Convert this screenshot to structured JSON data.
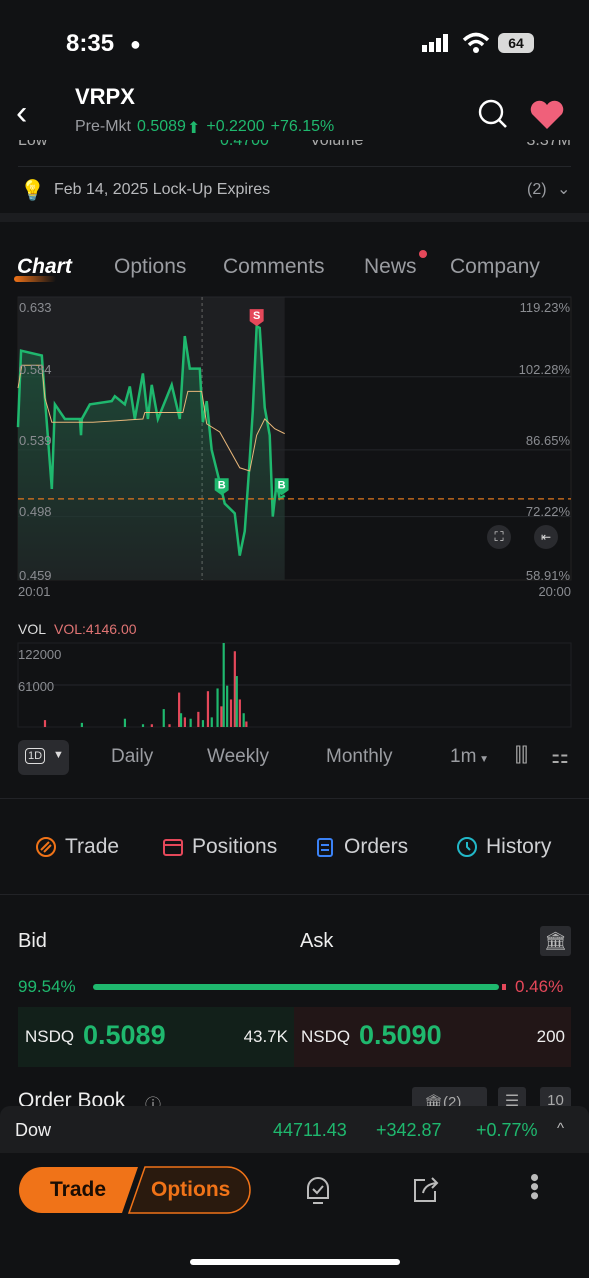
{
  "status": {
    "time": "8:35",
    "battery": "64"
  },
  "header": {
    "symbol": "VRPX",
    "session": "Pre-Mkt",
    "price": "0.5089",
    "change": "+0.2200",
    "change_pct": "+76.15%",
    "partial_row": {
      "low_label": "Low",
      "low_value": "0.4700",
      "volume_label": "Volume",
      "volume_value": "3.37M"
    }
  },
  "event": {
    "text": "Feb 14, 2025 Lock-Up Expires",
    "count": "(2)"
  },
  "tabs": [
    {
      "label": "Chart",
      "active": true
    },
    {
      "label": "Options"
    },
    {
      "label": "Comments"
    },
    {
      "label": "News",
      "dot": true
    },
    {
      "label": "Company"
    }
  ],
  "colors": {
    "up": "#1fb86e",
    "down": "#e5485a",
    "accent": "#f07318",
    "ma": "#e8b77a"
  },
  "chart_data": {
    "type": "line",
    "ylim": [
      0.459,
      0.633
    ],
    "y_ticks": [
      "0.633",
      "0.584",
      "0.539",
      "0.498",
      "0.459"
    ],
    "pct_ticks": [
      "119.23%",
      "102.28%",
      "86.65%",
      "72.22%",
      "58.91%"
    ],
    "x_ticks": [
      "20:01",
      "20:00"
    ],
    "reference_price": 0.5089,
    "session_divider": "04:00",
    "price": [
      [
        "20:01",
        0.553
      ],
      [
        "20:09",
        0.6
      ],
      [
        "21:03",
        0.597
      ],
      [
        "21:11",
        0.571
      ],
      [
        "21:29",
        0.515
      ],
      [
        "21:37",
        0.567
      ],
      [
        "22:03",
        0.558
      ],
      [
        "22:42",
        0.558
      ],
      [
        "22:45",
        0.548
      ],
      [
        "22:47",
        0.558
      ],
      [
        "23:08",
        0.567
      ],
      [
        "00:05",
        0.569
      ],
      [
        "00:13",
        0.572
      ],
      [
        "00:39",
        0.567
      ],
      [
        "00:52",
        0.578
      ],
      [
        "01:05",
        0.558
      ],
      [
        "01:26",
        0.586
      ],
      [
        "01:39",
        0.558
      ],
      [
        "01:49",
        0.579
      ],
      [
        "02:05",
        0.558
      ],
      [
        "02:41",
        0.579
      ],
      [
        "03:02",
        0.558
      ],
      [
        "03:15",
        0.609
      ],
      [
        "03:28",
        0.589
      ],
      [
        "03:54",
        0.589
      ],
      [
        "04:02",
        0.556
      ],
      [
        "04:12",
        0.569
      ],
      [
        "04:25",
        0.539
      ],
      [
        "04:46",
        0.519
      ],
      [
        "04:59",
        0.506
      ],
      [
        "05:25",
        0.5
      ],
      [
        "05:38",
        0.474
      ],
      [
        "05:51",
        0.489
      ],
      [
        "06:02",
        0.526
      ],
      [
        "06:12",
        0.563
      ],
      [
        "06:22",
        0.615
      ],
      [
        "06:30",
        0.614
      ],
      [
        "06:43",
        0.565
      ],
      [
        "06:56",
        0.548
      ],
      [
        "07:04",
        0.498
      ],
      [
        "07:14",
        0.519
      ],
      [
        "07:22",
        0.509
      ],
      [
        "07:35",
        0.511
      ]
    ],
    "ma": [
      [
        "20:01",
        0.577
      ],
      [
        "20:11",
        0.591
      ],
      [
        "21:03",
        0.591
      ],
      [
        "21:11",
        0.571
      ],
      [
        "21:29",
        0.556
      ],
      [
        "23:16",
        0.556
      ],
      [
        "01:26",
        0.558
      ],
      [
        "01:31",
        0.562
      ],
      [
        "03:10",
        0.562
      ],
      [
        "03:23",
        0.575
      ],
      [
        "03:59",
        0.575
      ],
      [
        "04:12",
        0.555
      ],
      [
        "04:46",
        0.55
      ],
      [
        "05:38",
        0.528
      ],
      [
        "06:04",
        0.526
      ],
      [
        "06:22",
        0.548
      ],
      [
        "06:43",
        0.558
      ],
      [
        "07:09",
        0.552
      ],
      [
        "07:35",
        0.549
      ]
    ],
    "markers": [
      {
        "label": "S",
        "time": "06:22",
        "price": 0.62
      },
      {
        "label": "B",
        "time": "04:51",
        "price": 0.516
      },
      {
        "label": "B",
        "time": "07:27",
        "price": 0.516
      }
    ],
    "volume": {
      "label": "VOL",
      "current": "VOL:4146.00",
      "ticks": [
        "122000",
        "61000"
      ],
      "max": 122000,
      "bars": [
        [
          "21:11",
          10000,
          "down"
        ],
        [
          "22:47",
          6000,
          "up"
        ],
        [
          "00:39",
          12000,
          "up"
        ],
        [
          "01:26",
          4000,
          "up"
        ],
        [
          "01:49",
          4000,
          "down"
        ],
        [
          "02:20",
          26000,
          "up"
        ],
        [
          "02:35",
          4000,
          "down"
        ],
        [
          "03:00",
          50000,
          "down"
        ],
        [
          "03:05",
          20000,
          "up"
        ],
        [
          "03:15",
          14000,
          "down"
        ],
        [
          "03:30",
          12000,
          "up"
        ],
        [
          "03:50",
          22000,
          "down"
        ],
        [
          "04:02",
          10000,
          "up"
        ],
        [
          "04:15",
          52000,
          "down"
        ],
        [
          "04:25",
          14000,
          "up"
        ],
        [
          "04:40",
          56000,
          "up"
        ],
        [
          "04:50",
          30000,
          "down"
        ],
        [
          "04:56",
          122000,
          "up"
        ],
        [
          "05:05",
          60000,
          "up"
        ],
        [
          "05:15",
          40000,
          "down"
        ],
        [
          "05:25",
          110000,
          "down"
        ],
        [
          "05:30",
          74000,
          "up"
        ],
        [
          "05:38",
          40000,
          "down"
        ],
        [
          "05:48",
          20000,
          "up"
        ],
        [
          "05:55",
          8000,
          "down"
        ]
      ]
    }
  },
  "periods": {
    "selected": "1D",
    "items": [
      "Daily",
      "Weekly",
      "Monthly"
    ],
    "interval": "1m"
  },
  "actions": [
    {
      "label": "Trade",
      "icon": "trade-icon",
      "color": "#f07318"
    },
    {
      "label": "Positions",
      "icon": "positions-icon",
      "color": "#e5485a"
    },
    {
      "label": "Orders",
      "icon": "orders-icon",
      "color": "#3b82f6"
    },
    {
      "label": "History",
      "icon": "history-icon",
      "color": "#22b8c8"
    }
  ],
  "quote": {
    "bid_label": "Bid",
    "ask_label": "Ask",
    "bid_pct": "99.54%",
    "ask_pct": "0.46%",
    "bid_ratio": 0.9954,
    "bid_exch": "NSDQ",
    "bid_price": "0.5089",
    "bid_size": "43.7K",
    "ask_exch": "NSDQ",
    "ask_price": "0.5090",
    "ask_size": "200"
  },
  "order_book": {
    "label": "Order Book",
    "exch_count": "(2)",
    "depth": "10"
  },
  "ticker": {
    "name": "Dow",
    "value": "44711.43",
    "change": "+342.87",
    "pct": "+0.77%"
  },
  "bottom": {
    "trade": "Trade",
    "options": "Options"
  }
}
